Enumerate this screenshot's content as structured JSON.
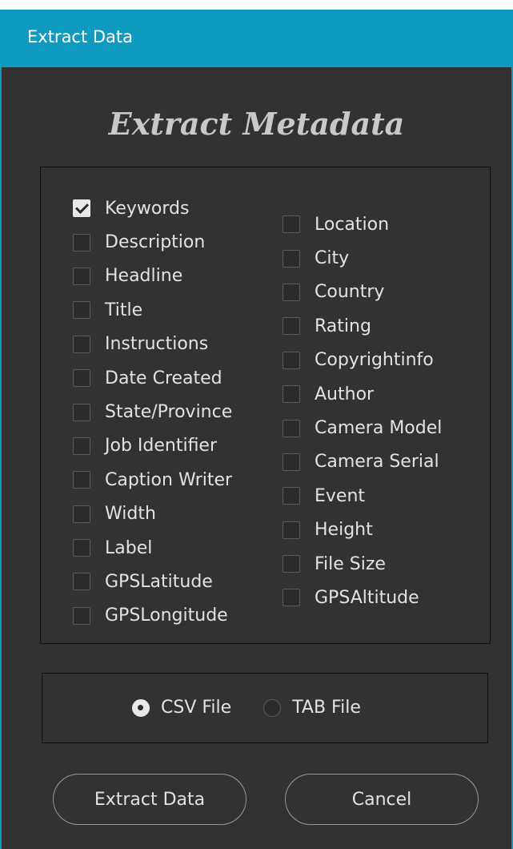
{
  "window": {
    "title": "Extract Data"
  },
  "heading": "Extract Metadata",
  "fields": {
    "left": [
      {
        "label": "Keywords",
        "checked": true
      },
      {
        "label": "Description",
        "checked": false
      },
      {
        "label": "Headline",
        "checked": false
      },
      {
        "label": "Title",
        "checked": false
      },
      {
        "label": "Instructions",
        "checked": false
      },
      {
        "label": "Date Created",
        "checked": false
      },
      {
        "label": "State/Province",
        "checked": false
      },
      {
        "label": "Job Identifier",
        "checked": false
      },
      {
        "label": "Caption Writer",
        "checked": false
      },
      {
        "label": "Width",
        "checked": false
      },
      {
        "label": "Label",
        "checked": false
      },
      {
        "label": "GPSLatitude",
        "checked": false
      },
      {
        "label": "GPSLongitude",
        "checked": false
      }
    ],
    "right": [
      {
        "label": "Location",
        "checked": false
      },
      {
        "label": "City",
        "checked": false
      },
      {
        "label": "Country",
        "checked": false
      },
      {
        "label": "Rating",
        "checked": false
      },
      {
        "label": "Copyrightinfo",
        "checked": false
      },
      {
        "label": "Author",
        "checked": false
      },
      {
        "label": "Camera Model",
        "checked": false
      },
      {
        "label": "Camera Serial",
        "checked": false
      },
      {
        "label": "Event",
        "checked": false
      },
      {
        "label": "Height",
        "checked": false
      },
      {
        "label": "File Size",
        "checked": false
      },
      {
        "label": "GPSAltitude",
        "checked": false
      }
    ]
  },
  "format": {
    "options": [
      {
        "label": "CSV File",
        "selected": true
      },
      {
        "label": "TAB File",
        "selected": false
      }
    ]
  },
  "buttons": {
    "extract_label": "Extract Data",
    "cancel_label": "Cancel"
  },
  "colors": {
    "titlebar": "#0f9ac0",
    "background": "#323232",
    "text": "#e2e2e2"
  }
}
